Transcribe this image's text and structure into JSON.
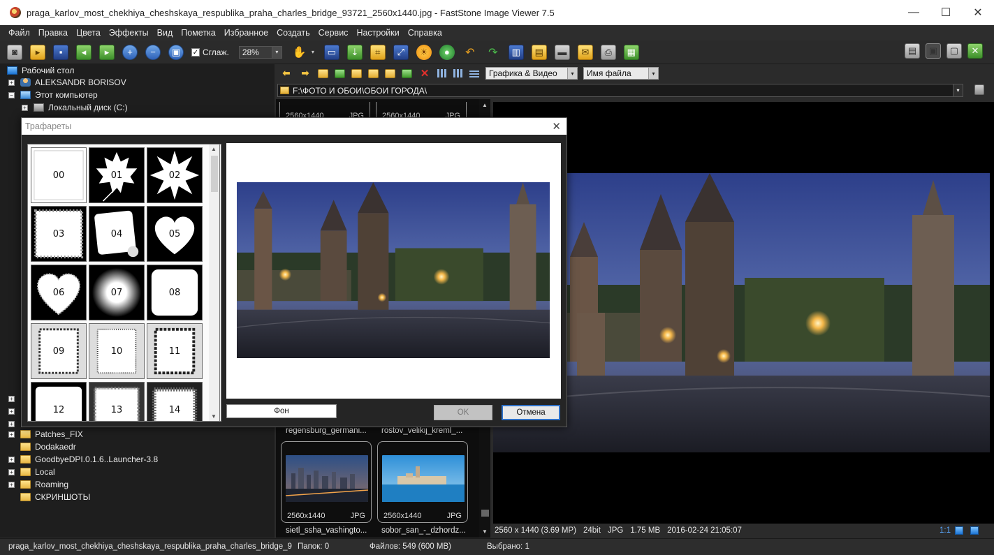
{
  "window": {
    "title": "praga_karlov_most_chekhiya_cheshskaya_respublika_praha_charles_bridge_93721_2560x1440.jpg - FastStone Image Viewer 7.5",
    "minimize": "—",
    "maximize": "☐",
    "close": "✕"
  },
  "menu": [
    "Файл",
    "Правка",
    "Цвета",
    "Эффекты",
    "Вид",
    "Пометка",
    "Избранное",
    "Создать",
    "Сервис",
    "Настройки",
    "Справка"
  ],
  "toolbar": {
    "smooth_label": "Сглаж.",
    "smooth_checked": "✓",
    "zoom_value": "28%",
    "dropdown_arrow": "▾"
  },
  "tree": {
    "items": [
      {
        "label": "Рабочий стол"
      },
      {
        "label": "ALEKSANDR BORISOV",
        "expander": "+"
      },
      {
        "label": "Этот компьютер",
        "expander": "−"
      },
      {
        "label": "Локальный диск (C:)",
        "expander": "+"
      },
      {
        "label": "Patches_FIX",
        "expander": "+"
      },
      {
        "label": "Dodakaedr"
      },
      {
        "label": "GoodbyeDPI.0.1.6..Launcher-3.8",
        "expander": "+"
      },
      {
        "label": "Local",
        "expander": "+"
      },
      {
        "label": "Roaming",
        "expander": "+"
      },
      {
        "label": "СКРИНШОТЫ"
      }
    ],
    "partial_expanders": [
      "+",
      "+",
      "+"
    ]
  },
  "navbar": {
    "back": "⬅",
    "forward": "➡",
    "delete": "✕",
    "filter": "Графика & Видео",
    "sort": "Имя файла"
  },
  "path": {
    "value": "F:\\ФОТО И ОБОИ\\ОБОИ ГОРОДА\\"
  },
  "thumbnails": [
    {
      "size": "2560x1440",
      "format": "JPG",
      "name": ""
    },
    {
      "size": "2560x1440",
      "format": "JPG",
      "name": ""
    },
    {
      "size": "",
      "format": "",
      "name": "regensburg_germani..."
    },
    {
      "size": "",
      "format": "",
      "name": "rostov_velikij_kreml_..."
    },
    {
      "size": "2560x1440",
      "format": "JPG",
      "name": "sietl_ssha_vashingto..."
    },
    {
      "size": "2560x1440",
      "format": "JPG",
      "name": "sobor_san_-_dzhordz..."
    }
  ],
  "preview": {
    "dimensions": "2560 x 1440 (3.69 MP)",
    "bitdepth": "24bit",
    "format": "JPG",
    "filesize": "1.75 MB",
    "datetime": "2016-02-24 21:05:07",
    "ratio": "1:1"
  },
  "statusbar": {
    "filename": "praga_karlov_most_chekhiya_cheshskaya_respublika_praha_charles_bridge_9",
    "folders": "Папок: 0",
    "files": "Файлов: 549 (600 MB)",
    "selected": "Выбрано: 1"
  },
  "dialog": {
    "title": "Трафареты",
    "close": "✕",
    "masks": [
      "00",
      "01",
      "02",
      "03",
      "04",
      "05",
      "06",
      "07",
      "08",
      "09",
      "10",
      "11",
      "12",
      "13",
      "14"
    ],
    "background_button": "Фон",
    "ok_button": "OK",
    "cancel_button": "Отмена"
  },
  "colors": {
    "background": "#2b2b2b",
    "panel": "#1e1e1e",
    "accent": "#2f71c8"
  }
}
